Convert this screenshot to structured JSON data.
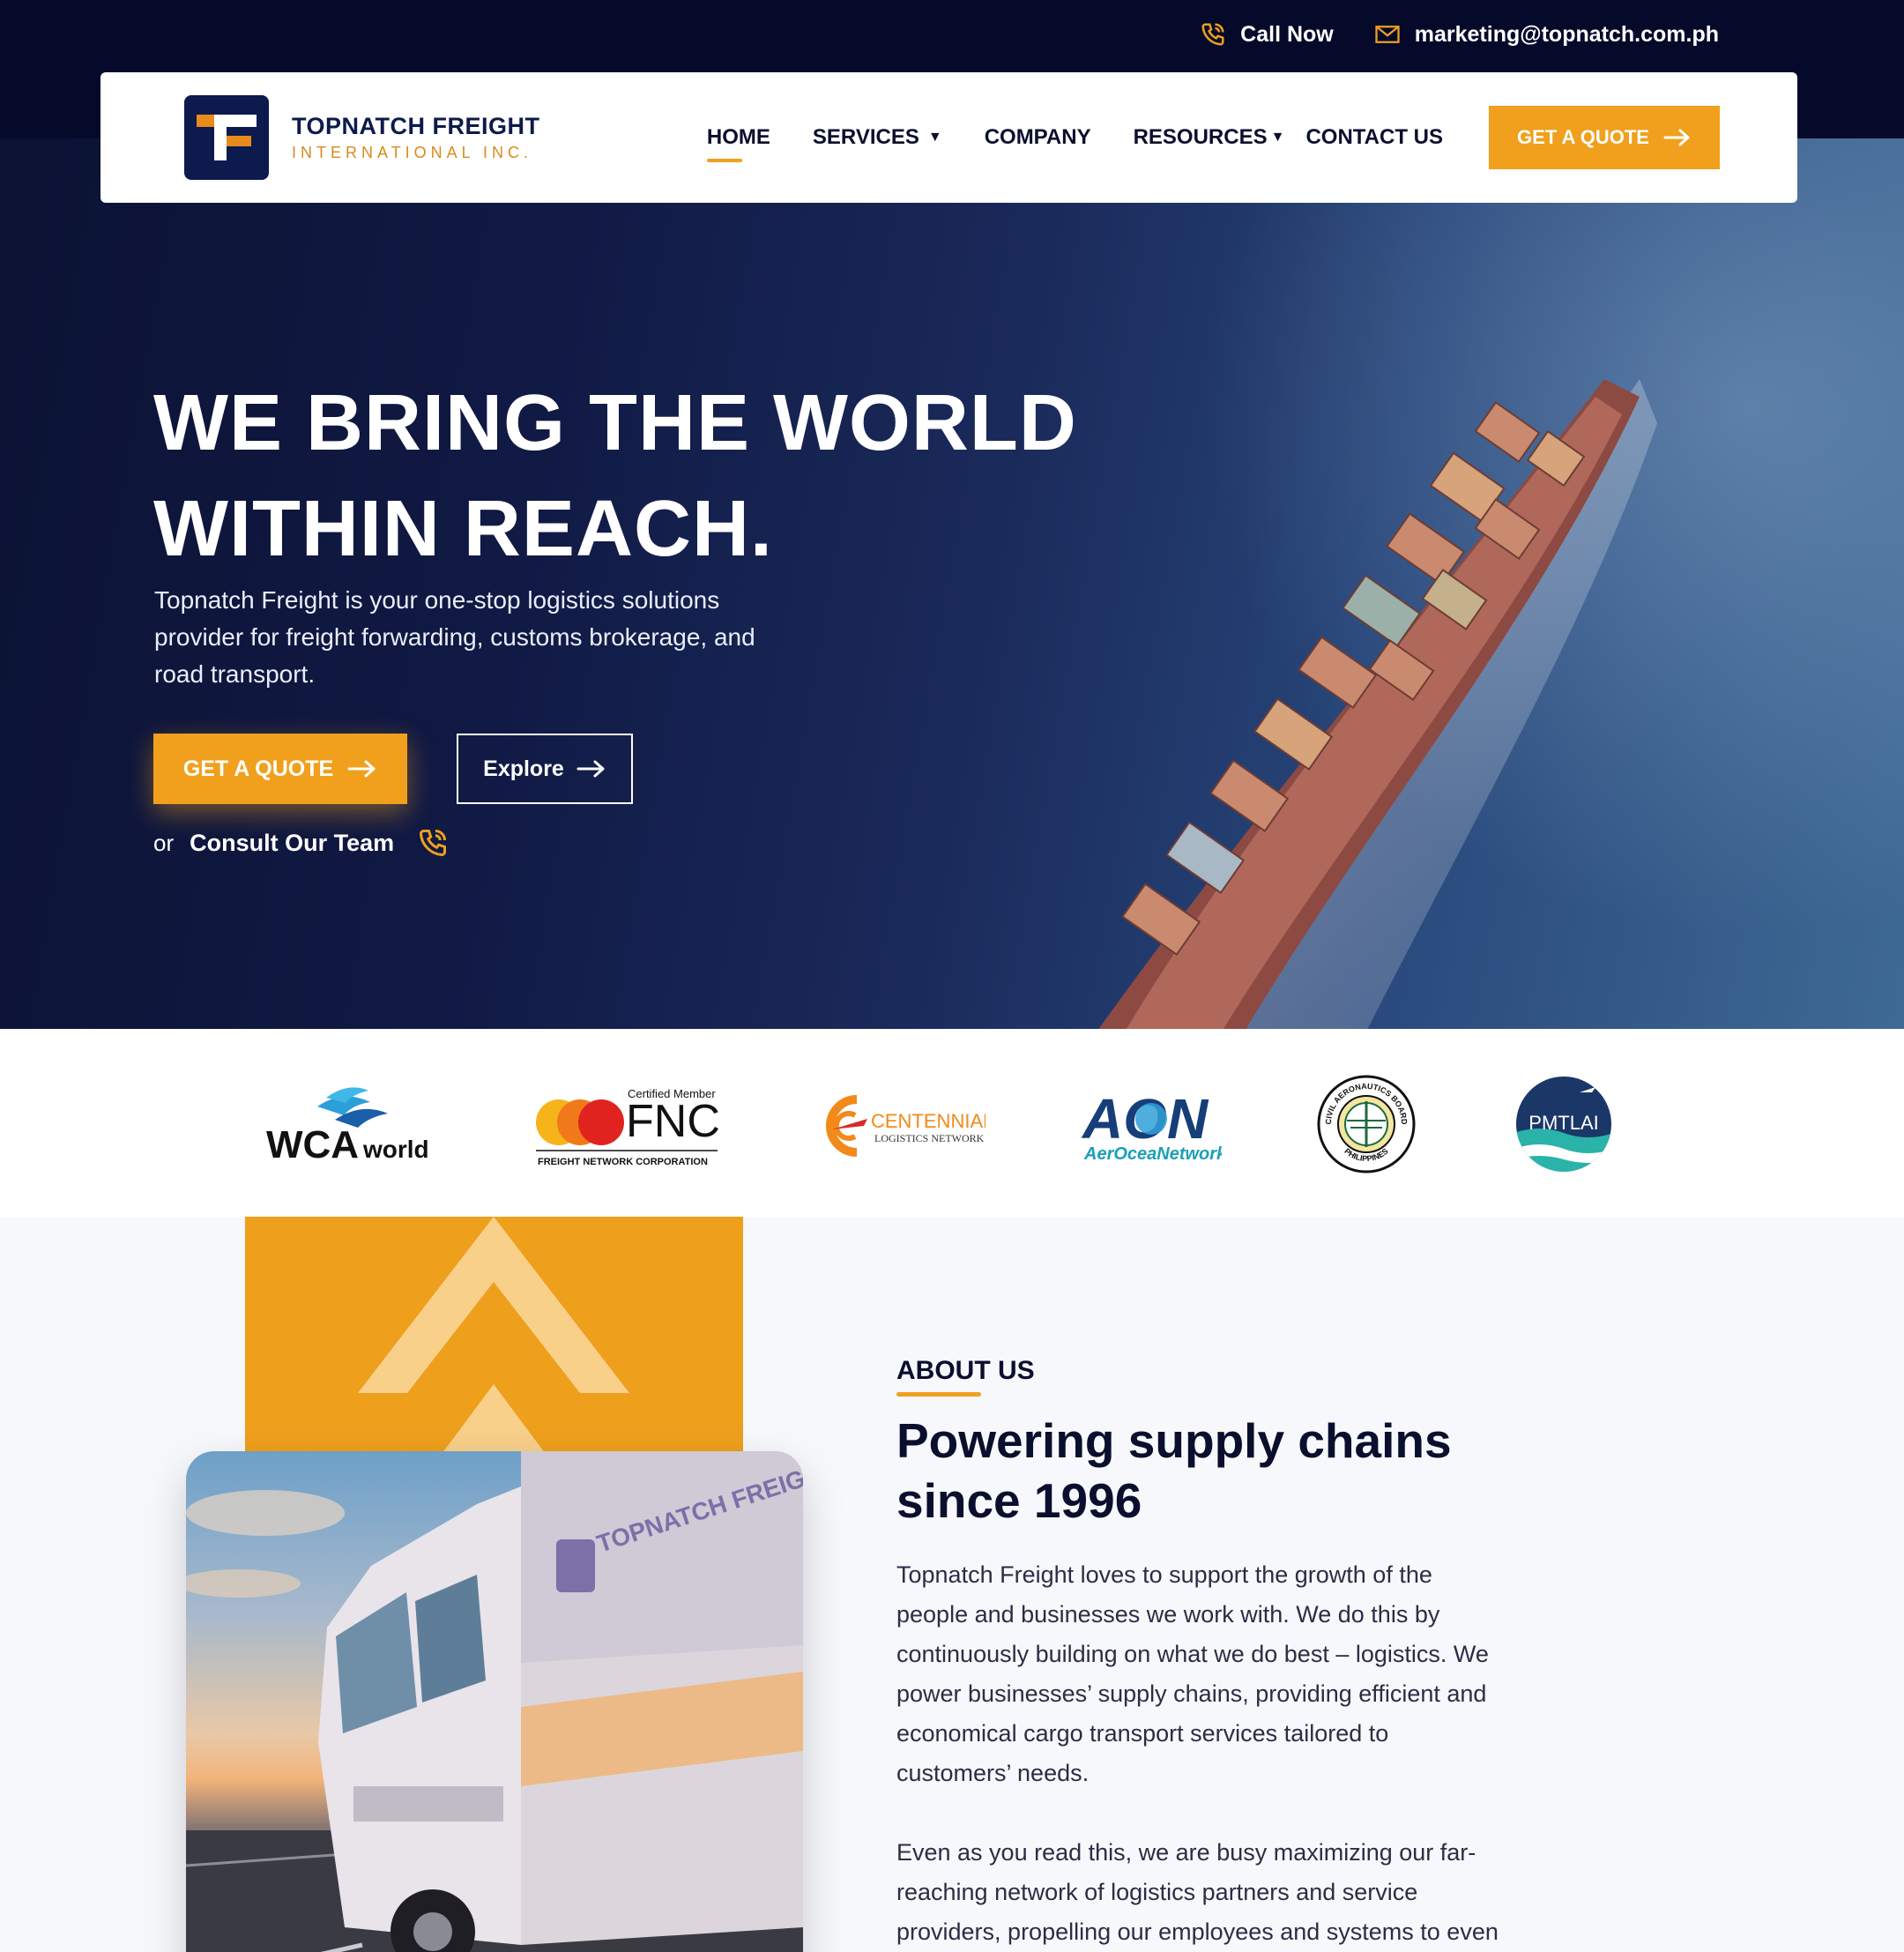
{
  "topbar": {
    "call_label": "Call Now",
    "email": "marketing@topnatch.com.ph"
  },
  "brand": {
    "name_line1": "TOPNATCH FREIGHT",
    "name_line2": "INTERNATIONAL INC.",
    "primary_color": "#0d1a4d",
    "accent_color": "#f0a01c"
  },
  "nav": {
    "items": [
      {
        "label": "HOME",
        "active": true
      },
      {
        "label": "SERVICES",
        "dropdown": true
      },
      {
        "label": "COMPANY"
      },
      {
        "label": "RESOURCES",
        "dropdown": true
      },
      {
        "label": "CONTACT US"
      }
    ],
    "cta_label": "GET A QUOTE"
  },
  "hero": {
    "title_line1": "WE BRING THE WORLD",
    "title_line2": "WITHIN REACH.",
    "subtitle": "Topnatch Freight is your one-stop logistics solutions provider for freight forwarding, customs brokerage, and road transport.",
    "cta_label": "GET A QUOTE",
    "explore_label": "Explore",
    "consult_prefix": "or",
    "consult_label": "Consult Our Team"
  },
  "partners": {
    "wca": {
      "main": "WCA",
      "sub": "world"
    },
    "fnc": {
      "top": "Certified Member",
      "main": "FNC",
      "bottom": "FREIGHT NETWORK CORPORATION"
    },
    "centennial": {
      "main": "CENTENNIAL",
      "sub": "LOGISTICS NETWORK"
    },
    "aon": {
      "main": "AON",
      "sub": "AerOceaNetwork"
    },
    "cab": {
      "top": "CIVIL AERONAUTICS BOARD",
      "bottom": "PHILIPPINES"
    },
    "pmtlai": {
      "main": "PMTLAI"
    }
  },
  "truck_brand": "TOPNATCH FREIGHT",
  "about": {
    "label": "ABOUT US",
    "title_line1": "Powering supply chains",
    "title_line2": "since 1996",
    "p1_lines": [
      "Topnatch Freight loves to support the growth of the",
      "people and businesses we work with. We do this by",
      "continuously building on what we do best – logistics. We",
      "power businesses’ supply chains, providing efficient and",
      "economical cargo transport services tailored to",
      "customers’ needs."
    ],
    "p2_lines": [
      "Even as you read this, we are busy maximizing our far-",
      "reaching network of logistics partners and service",
      "providers, propelling our employees and systems to even"
    ]
  }
}
